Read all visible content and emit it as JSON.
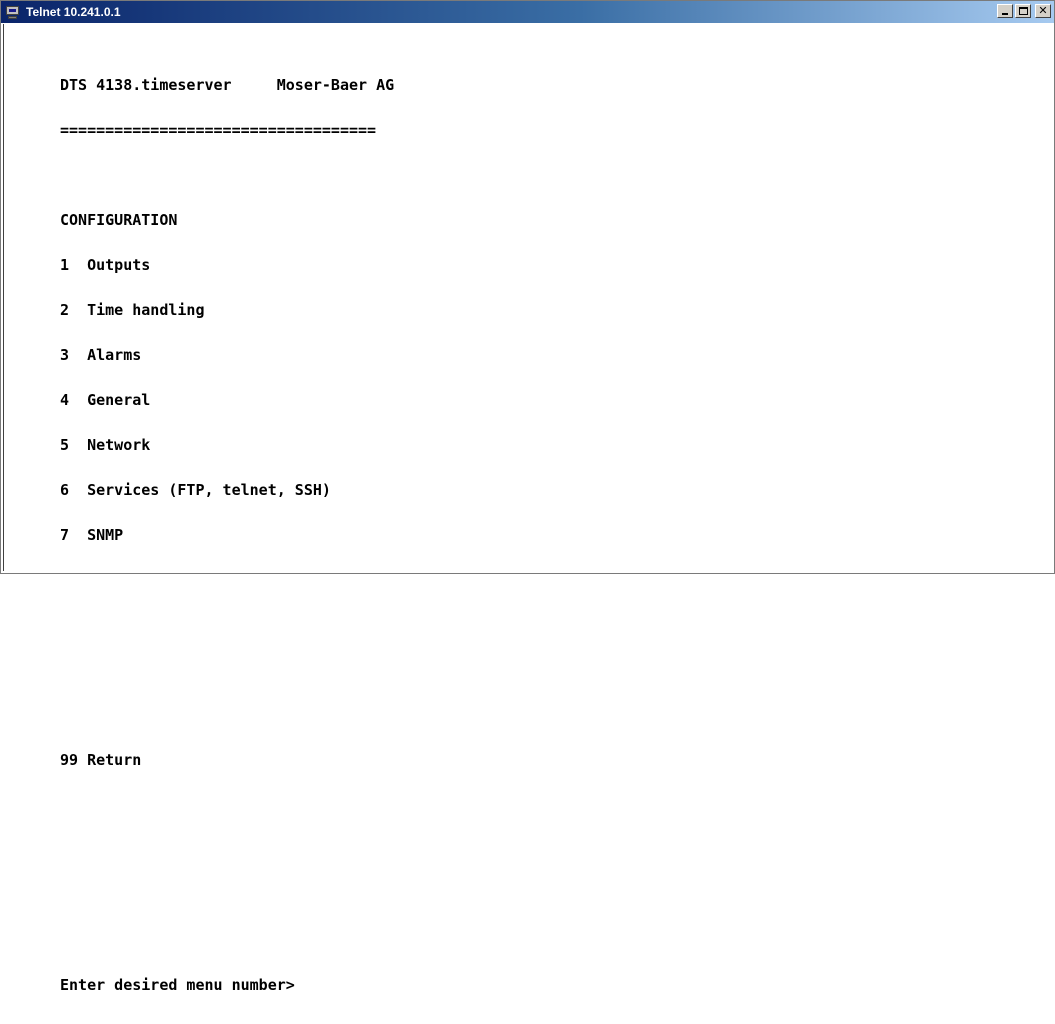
{
  "window": {
    "title": "Telnet 10.241.0.1",
    "controls": {
      "minimize_icon": "minimize-icon",
      "maximize_icon": "maximize-icon",
      "close_icon": "close-icon"
    },
    "titlebar_colors": [
      "#0a246a",
      "#3a6ea5",
      "#a6caf0"
    ]
  },
  "terminal": {
    "header": "DTS 4138.timeserver     Moser-Baer AG",
    "separator": "===================================",
    "section_title": "CONFIGURATION",
    "menu_items": [
      {
        "number": "1",
        "label": "Outputs"
      },
      {
        "number": "2",
        "label": "Time handling"
      },
      {
        "number": "3",
        "label": "Alarms"
      },
      {
        "number": "4",
        "label": "General"
      },
      {
        "number": "5",
        "label": "Network"
      },
      {
        "number": "6",
        "label": "Services (FTP, telnet, SSH)"
      },
      {
        "number": "7",
        "label": "SNMP"
      }
    ],
    "return_item": {
      "number": "99",
      "label": "Return"
    },
    "prompt": "Enter desired menu number>"
  }
}
